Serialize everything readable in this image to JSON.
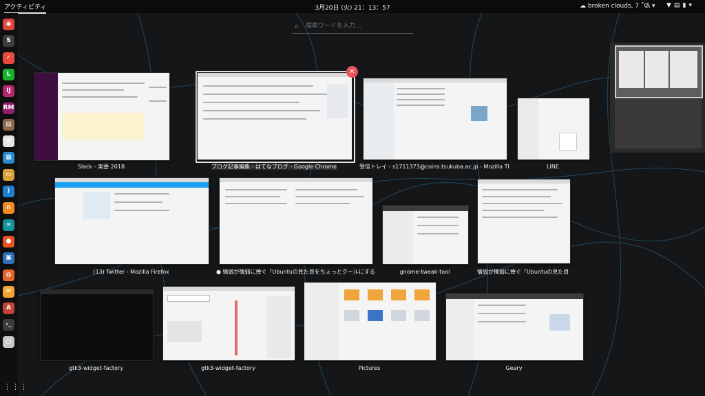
{
  "topbar": {
    "activities": "アクティビティ",
    "clock": "3月20日 (火) 21：13：57",
    "weather": "broken clouds, 7 ˚C",
    "input_method": "A",
    "system_icons": [
      "wifi-icon",
      "clipboard-icon",
      "battery-icon"
    ]
  },
  "search": {
    "placeholder": "検索ワードを入力…"
  },
  "dash": {
    "items": [
      {
        "icon": "chrome-icon",
        "color": "#e0453a",
        "glyph": "◉"
      },
      {
        "icon": "slack-icon",
        "color": "#3e3e3e",
        "glyph": "S"
      },
      {
        "icon": "todoist-icon",
        "color": "#e84b3c",
        "glyph": "✓"
      },
      {
        "icon": "line-icon",
        "color": "#18b22f",
        "glyph": "L"
      },
      {
        "icon": "intellij-icon",
        "color": "#b5286b",
        "glyph": "IJ"
      },
      {
        "icon": "rubymine-icon",
        "color": "#8f1f6a",
        "glyph": "RM"
      },
      {
        "icon": "files-icon",
        "color": "#8d6b4a",
        "glyph": "▤"
      },
      {
        "icon": "notes-icon",
        "color": "#e5e5e5",
        "glyph": "≡"
      },
      {
        "icon": "calendar-icon",
        "color": "#2a8dd4",
        "glyph": "▦"
      },
      {
        "icon": "folder-icon",
        "color": "#d9a037",
        "glyph": "▭"
      },
      {
        "icon": "vscode-icon",
        "color": "#1f7fcf",
        "glyph": "⟩"
      },
      {
        "icon": "headphones-icon",
        "color": "#f08a24",
        "glyph": "∩"
      },
      {
        "icon": "arduino-icon",
        "color": "#14939b",
        "glyph": "∞"
      },
      {
        "icon": "ubuntu-software-icon",
        "color": "#e95420",
        "glyph": "●"
      },
      {
        "icon": "virtualbox-icon",
        "color": "#2e6fb9",
        "glyph": "▣"
      },
      {
        "icon": "firefox-icon",
        "color": "#e8652a",
        "glyph": "◍"
      },
      {
        "icon": "mail-icon",
        "color": "#f3a531",
        "glyph": "✉"
      },
      {
        "icon": "fonts-icon",
        "color": "#c2433a",
        "glyph": "A"
      },
      {
        "icon": "terminal-icon",
        "color": "#3b3b3b",
        "glyph": "›_"
      },
      {
        "icon": "screenshot-icon",
        "color": "#c8c8c8",
        "glyph": "▢"
      }
    ],
    "apps_grid": "⋮⋮⋮"
  },
  "windows": [
    {
      "title": "Slack - 実委 2018"
    },
    {
      "title": "ブログ記事編集 - はてなブログ - Google Chrome"
    },
    {
      "title": "受信トレイ - s1711373@coins.tsukuba.ac.jp - Mozilla Th…"
    },
    {
      "title": "LINE"
    },
    {
      "title": "(13) Twitter - Mozilla Firefox"
    },
    {
      "title": "● 情弱が情弱に捧ぐ「Ubuntuの見た目をちょっとクールにする方…"
    },
    {
      "title": "gnome-tweak-tool"
    },
    {
      "title": "情弱が情弱に捧ぐ「Ubuntuの見た目…"
    },
    {
      "title": "gtk3-widget-factory"
    },
    {
      "title": "gtk3-widget-factory"
    },
    {
      "title": "Pictures"
    },
    {
      "title": "Geary"
    }
  ],
  "close_button": "✕"
}
